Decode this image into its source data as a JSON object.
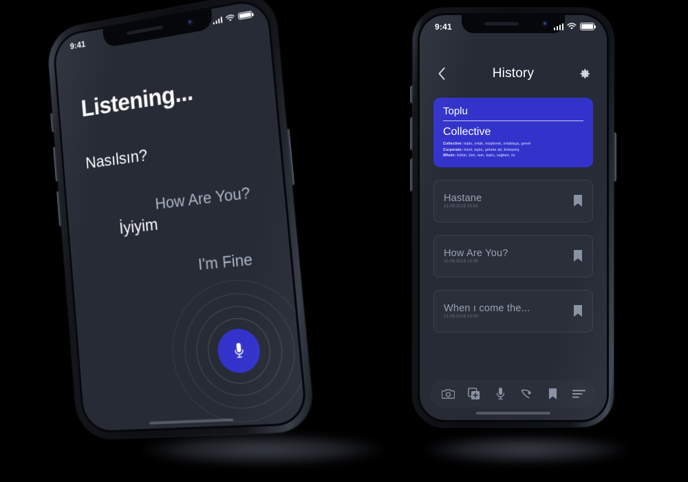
{
  "background_color": "#000000",
  "accent_color": "#3333cc",
  "screen_bg": "#262b36",
  "card_bg": "#2a2f3a",
  "phone_left": {
    "status_bar": {
      "time": "9:41",
      "signal": "cellular-bars-icon",
      "wifi": "wifi-icon",
      "battery": "battery-full-icon"
    },
    "title": "Listening...",
    "lines": [
      {
        "source": "Nasılsın?",
        "target": "How Are You?"
      },
      {
        "source": "İyiyim",
        "target": "I'm Fine"
      }
    ],
    "mic_button": {
      "icon": "microphone-icon",
      "color": "#3333cc"
    }
  },
  "phone_right": {
    "status_bar": {
      "time": "9:41",
      "signal": "cellular-bars-icon",
      "wifi": "wifi-icon",
      "battery": "battery-full-icon"
    },
    "navbar": {
      "back": "chevron-left-icon",
      "title": "History",
      "settings": "gear-icon"
    },
    "featured_card": {
      "source_word": "Toplu",
      "translated_word": "Collective",
      "definitions": [
        {
          "label": "Collective:",
          "values": " toplu, ortak, müşterek, ortaklaşa, genel"
        },
        {
          "label": "Corporate:",
          "values": " tüzel, toplu, şirkete ait, birleşmiş"
        },
        {
          "label": "Whole:",
          "values": " bütün, tüm, tam, toplu, sağlam, öz"
        }
      ]
    },
    "history_items": [
      {
        "title": "Hastane",
        "date": "12.09.2019 13:00",
        "bookmark": "bookmark-icon"
      },
      {
        "title": "How Are You?",
        "date": "10.09.2019 13:00",
        "bookmark": "bookmark-icon"
      },
      {
        "title": "When ı come the...",
        "date": "12.09.2019 13:00",
        "bookmark": "bookmark-icon"
      }
    ],
    "tabbar": [
      {
        "name": "camera",
        "icon": "camera-icon"
      },
      {
        "name": "add-document",
        "icon": "add-document-icon"
      },
      {
        "name": "voice",
        "icon": "microphone-icon"
      },
      {
        "name": "handwriting",
        "icon": "pen-draw-icon"
      },
      {
        "name": "bookmarks",
        "icon": "bookmark-icon"
      },
      {
        "name": "list",
        "icon": "list-lines-icon"
      }
    ]
  }
}
